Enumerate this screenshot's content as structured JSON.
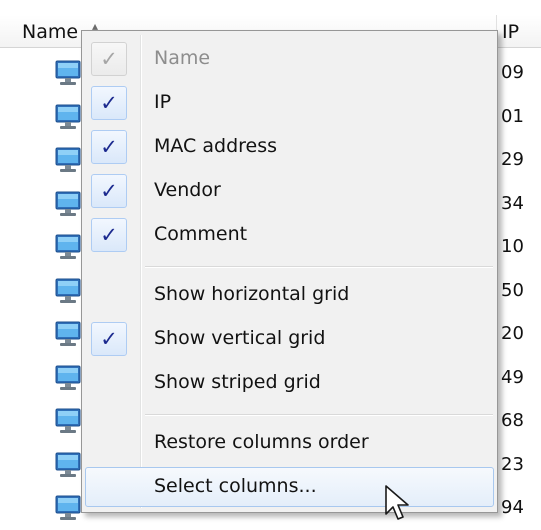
{
  "list": {
    "columns": {
      "name": "Name",
      "ip": "IP"
    },
    "rows": [
      {
        "ip_suffix": "09"
      },
      {
        "ip_suffix": "01"
      },
      {
        "ip_suffix": "29"
      },
      {
        "ip_suffix": "34"
      },
      {
        "ip_suffix": "10"
      },
      {
        "ip_suffix": "50"
      },
      {
        "ip_suffix": "20"
      },
      {
        "ip_suffix": "49"
      },
      {
        "ip_suffix": "68"
      },
      {
        "ip_suffix": "23"
      },
      {
        "ip_suffix": "94"
      }
    ],
    "row_icon": "computer-icon",
    "sort_icon": "sort-ascending-icon"
  },
  "menu": {
    "items": [
      {
        "label": "Name",
        "checked": true,
        "disabled": true
      },
      {
        "label": "IP",
        "checked": true,
        "disabled": false
      },
      {
        "label": "MAC address",
        "checked": true,
        "disabled": false
      },
      {
        "label": "Vendor",
        "checked": true,
        "disabled": false
      },
      {
        "label": "Comment",
        "checked": true,
        "disabled": false
      },
      {
        "label": "Show horizontal grid",
        "checked": false,
        "disabled": false
      },
      {
        "label": "Show vertical grid",
        "checked": true,
        "disabled": false
      },
      {
        "label": "Show striped grid",
        "checked": false,
        "disabled": false
      },
      {
        "label": "Restore columns order",
        "checked": false,
        "disabled": false
      },
      {
        "label": "Select columns...",
        "checked": false,
        "disabled": false,
        "hovered": true
      }
    ],
    "check_glyph": "✓"
  },
  "colors": {
    "check": "#1c2a8f",
    "hover_border": "#a8c8ef",
    "menu_bg": "#f1f1f1"
  }
}
